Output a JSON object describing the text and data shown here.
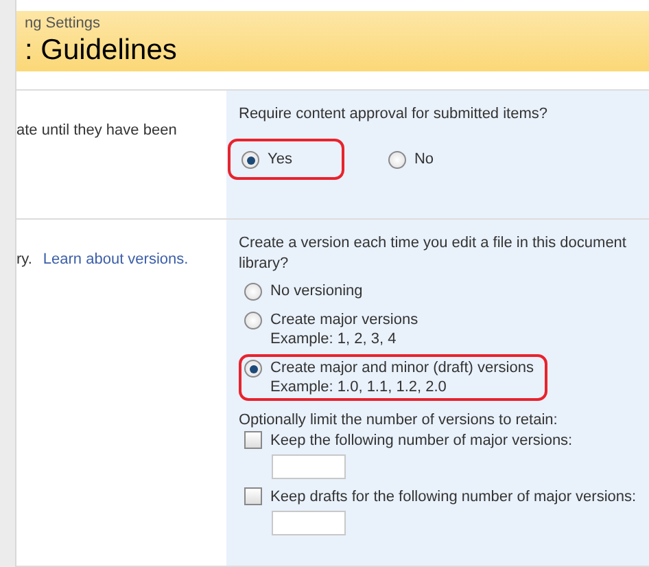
{
  "header": {
    "breadcrumb": "ng Settings",
    "title": ": Guidelines"
  },
  "sections": [
    {
      "description": "ate until they have been",
      "question": "Require content approval for submitted items?",
      "kind": "inline",
      "options": [
        {
          "label": "Yes",
          "selected": true,
          "highlighted": true
        },
        {
          "label": "No",
          "selected": false,
          "highlighted": false
        }
      ]
    },
    {
      "description": "ry.",
      "link": "Learn about versions.",
      "question": "Create a version each time you edit a file in this document library?",
      "kind": "stacked",
      "options": [
        {
          "label": "No versioning",
          "selected": false,
          "highlighted": false
        },
        {
          "label": "Create major versions",
          "example": "Example: 1, 2, 3, 4",
          "selected": false,
          "highlighted": false
        },
        {
          "label": "Create major and minor (draft) versions",
          "example": "Example: 1.0, 1.1, 1.2, 2.0",
          "selected": true,
          "highlighted": true
        }
      ],
      "limit": {
        "label": "Optionally limit the number of versions to retain:",
        "items": [
          {
            "label": "Keep the following number of major versions:",
            "checked": false
          },
          {
            "label": "Keep drafts for the following number of major versions:",
            "checked": false
          }
        ]
      }
    }
  ]
}
